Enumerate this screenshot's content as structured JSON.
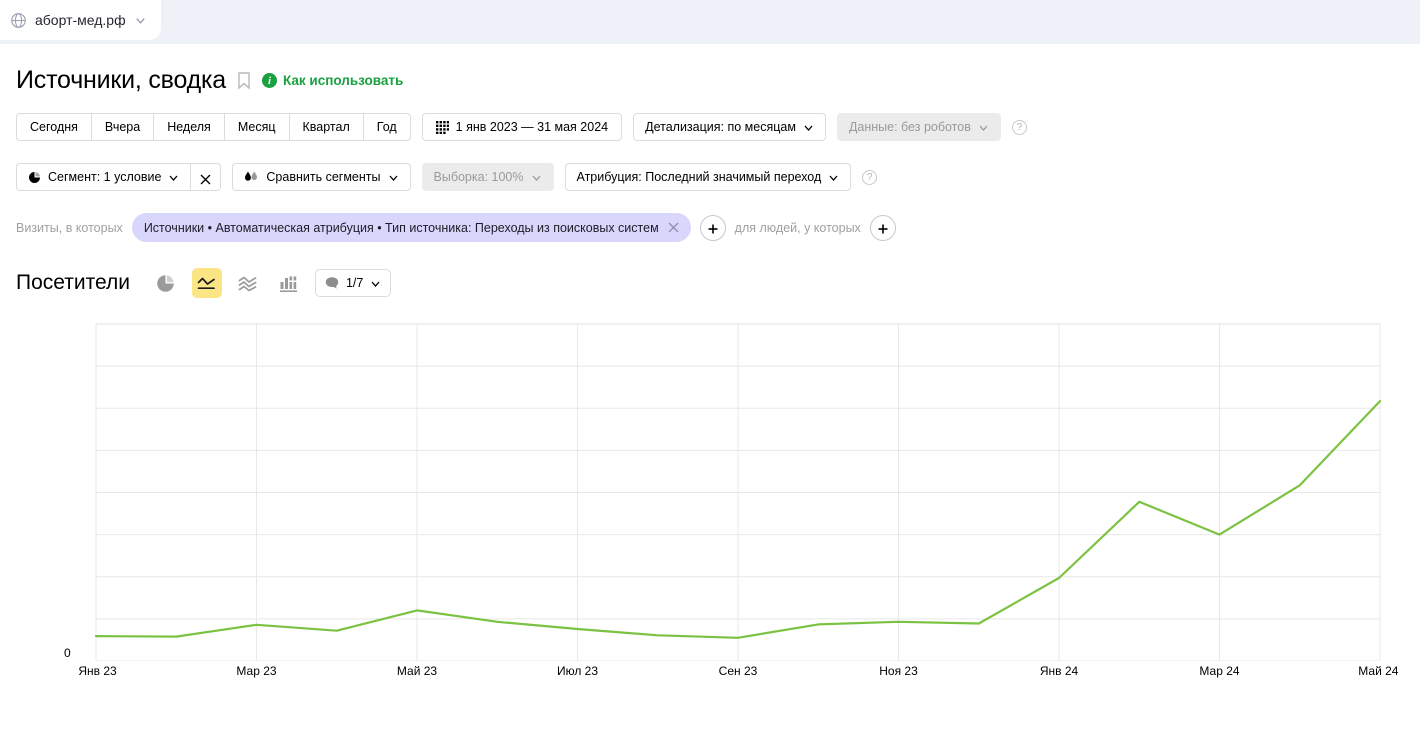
{
  "browser_tab": {
    "site": "аборт-мед.рф",
    "globe_icon": "globe-icon",
    "chevron_icon": "chevron-down-icon"
  },
  "header": {
    "title": "Источники, сводка",
    "bookmark_icon": "bookmark-icon",
    "info_icon": "info-icon",
    "info_char": "i",
    "howto_label": "Как использовать"
  },
  "toolbar": {
    "period_buttons": [
      "Сегодня",
      "Вчера",
      "Неделя",
      "Месяц",
      "Квартал",
      "Год"
    ],
    "date_range": "1 янв 2023 — 31 мая 2024",
    "date_icon": "calendar-grid-icon",
    "detail": "Детализация: по месяцам",
    "data_robots": "Данные: без роботов",
    "help_icon": "question-mark-icon",
    "help_char": "?"
  },
  "toolbar2": {
    "segment": "Сегмент: 1 условие",
    "segment_icon": "pie-chart-icon",
    "segment_clear_icon": "close-icon",
    "compare": "Сравнить сегменты",
    "compare_icon": "compare-drops-icon",
    "sampling": "Выборка: 100%",
    "attribution": "Атрибуция: Последний значимый переход",
    "help_char": "?"
  },
  "filters": {
    "prefix_label": "Визиты, в которых",
    "chip": "Источники • Автоматическая атрибуция • Тип источника: Переходы из поисковых систем",
    "chip_close_icon": "close-icon",
    "chip_color": "#d8d6fb",
    "add_visit_filter_icon": "plus-icon",
    "middle_label": "для людей, у которых",
    "add_people_filter_icon": "plus-icon"
  },
  "metric": {
    "title": "Посетители",
    "tools": [
      {
        "name": "pie-chart-icon",
        "active": false
      },
      {
        "name": "line-chart-icon",
        "active": true
      },
      {
        "name": "area-chart-icon",
        "active": false
      },
      {
        "name": "bar-chart-icon",
        "active": false
      }
    ],
    "comments_label": "1/7",
    "comments_icon": "comment-bubble-icon",
    "comments_chevron": "chevron-down-icon"
  },
  "chart_data": {
    "type": "line",
    "title": "Посетители",
    "xlabel": "",
    "ylabel": "",
    "grid": true,
    "legend": null,
    "line_color": "#7cc242",
    "y_zero_label": "0",
    "ylim": [
      0,
      8
    ],
    "y_gridlines": 8,
    "x_tick_labels": [
      "Янв 23",
      "Мар 23",
      "Май 23",
      "Июл 23",
      "Сен 23",
      "Ноя 23",
      "Янв 24",
      "Мар 24",
      "Май 24"
    ],
    "categories": [
      "Янв 23",
      "Фев 23",
      "Мар 23",
      "Апр 23",
      "Май 23",
      "Июн 23",
      "Июл 23",
      "Авг 23",
      "Сен 23",
      "Окт 23",
      "Ноя 23",
      "Дек 23",
      "Янв 24",
      "Фев 24",
      "Мар 24",
      "Апр 24",
      "Май 24"
    ],
    "values": [
      0.59,
      0.58,
      0.86,
      0.72,
      1.2,
      0.93,
      0.76,
      0.61,
      0.55,
      0.87,
      0.93,
      0.89,
      1.97,
      3.78,
      3.0,
      4.17,
      6.17
    ]
  }
}
